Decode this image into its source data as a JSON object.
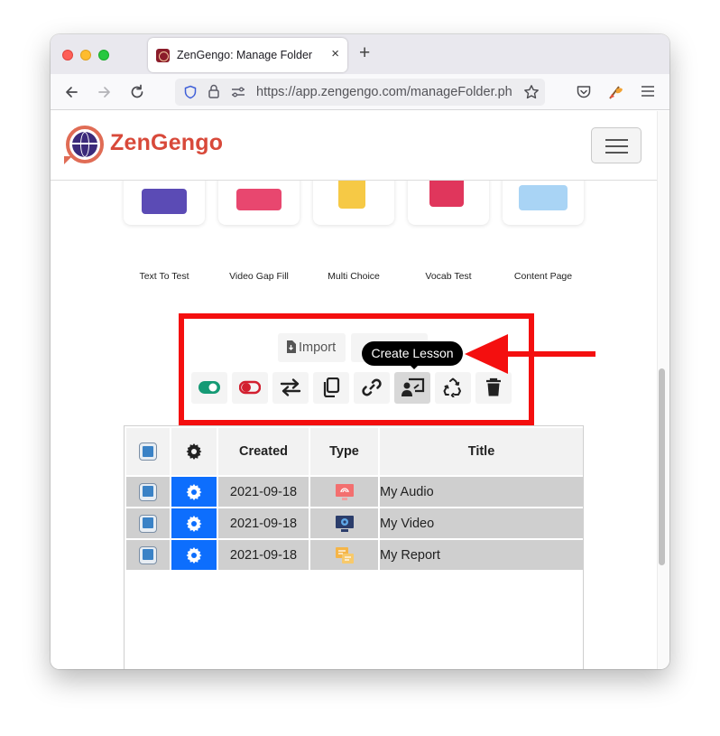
{
  "browser": {
    "tab_title": "ZenGengo: Manage Folder",
    "tab_close": "×",
    "new_tab": "+",
    "url": "https://app.zengengo.com/manageFolder.ph"
  },
  "site": {
    "logo_text": "ZenGengo"
  },
  "activity_tiles": [
    {
      "label": "Text To Test",
      "color": "#5b4bb5"
    },
    {
      "label": "Video Gap Fill",
      "color": "#e8476f"
    },
    {
      "label": "Multi Choice",
      "color": "#f6c945"
    },
    {
      "label": "Vocab Test",
      "color": "#e0365c"
    },
    {
      "label": "Content Page",
      "color": "#5aa0e8"
    }
  ],
  "toolbar": {
    "import_label": "Import",
    "tooltip": "Create Lesson",
    "buttons": [
      "toggle-on",
      "toggle-off",
      "swap",
      "copy",
      "link",
      "create-lesson",
      "recycle",
      "trash"
    ]
  },
  "table": {
    "headers": {
      "created": "Created",
      "type": "Type",
      "title": "Title"
    },
    "rows": [
      {
        "created": "2021-09-18",
        "type": "audio",
        "title": "My Audio"
      },
      {
        "created": "2021-09-18",
        "type": "video",
        "title": "My Video"
      },
      {
        "created": "2021-09-18",
        "type": "report",
        "title": "My Report"
      }
    ]
  },
  "colors": {
    "annotation": "#f40f0f",
    "accent_blue": "#0d6efd",
    "brand": "#d8493a"
  }
}
